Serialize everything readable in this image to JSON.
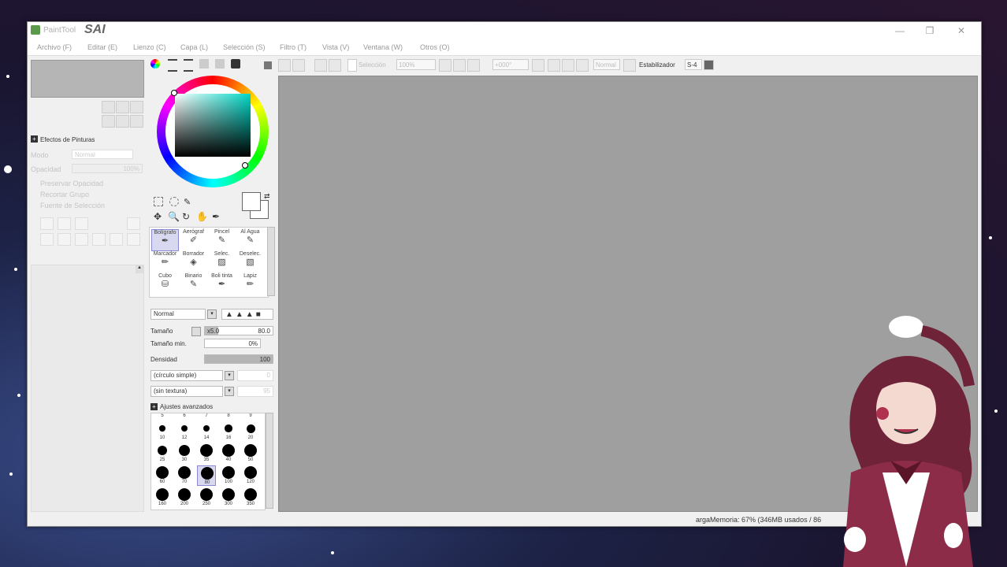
{
  "titlebar": {
    "title": "PaintTool",
    "brand": "SAI",
    "minimize": "—",
    "restore": "❐",
    "close": "✕"
  },
  "menu": [
    {
      "label": "Archivo (F)"
    },
    {
      "label": "Editar (E)"
    },
    {
      "label": "Lienzo (C)"
    },
    {
      "label": "Capa (L)"
    },
    {
      "label": "Selección (S)"
    },
    {
      "label": "Filtro (T)"
    },
    {
      "label": "Vista (V)"
    },
    {
      "label": "Ventana (W)"
    },
    {
      "label": "Otros (O)"
    }
  ],
  "toolbar": {
    "selection_label": "Selección",
    "zoom": "100%",
    "angle": "+000°",
    "blend": "Normal",
    "stabilizer_label": "Estabilizador",
    "stabilizer_value": "S-4"
  },
  "left_panel": {
    "paint_effects": "Efectos de Pinturas",
    "mode_label": "Modo",
    "mode_value": "Normal",
    "opacity_label": "Opacidad",
    "opacity_value": "100%",
    "preserve_opacity": "Preservar Opacidad",
    "clipping_group": "Recortar Grupo",
    "selection_source": "Fuente de Selección",
    "scroll_up": "▲"
  },
  "tools": [
    {
      "label": "Bolígrafo"
    },
    {
      "label": "Aerógraf"
    },
    {
      "label": "Pincel"
    },
    {
      "label": "Al Agua"
    },
    {
      "label": "Marcador"
    },
    {
      "label": "Borrador"
    },
    {
      "label": "Selec."
    },
    {
      "label": "Deselec."
    },
    {
      "label": "Cubo"
    },
    {
      "label": "Binario"
    },
    {
      "label": "Boli tinta"
    },
    {
      "label": "Lapiz"
    }
  ],
  "brush_settings": {
    "blend_mode": "Normal",
    "size_label": "Tamaño",
    "size_multiplier": "x5.0",
    "size_value": "80.0",
    "min_size_label": "Tamaño min.",
    "min_size_value": "0%",
    "density_label": "Densidad",
    "density_value": "100",
    "shape": "(círculo simple)",
    "shape_value": "0",
    "texture": "(sin textura)",
    "texture_value": "95",
    "advanced": "Ajustes avanzados"
  },
  "brush_sizes": {
    "top_row": [
      "5",
      "6",
      "7",
      "8",
      "9"
    ],
    "rows": [
      [
        "10",
        "12",
        "14",
        "16",
        "20"
      ],
      [
        "25",
        "30",
        "35",
        "40",
        "50"
      ],
      [
        "60",
        "70",
        "80",
        "100",
        "120"
      ],
      [
        "160",
        "200",
        "250",
        "300",
        "350"
      ]
    ],
    "selected": "80"
  },
  "status": {
    "memory": "argaMemoria: 67% (346MB usados / 86"
  },
  "colors": {
    "canvas": "#9f9f9f",
    "selected_tool": "#d8d8f0",
    "character_hair": "#6e2338",
    "character_dress": "#8c2c48"
  }
}
